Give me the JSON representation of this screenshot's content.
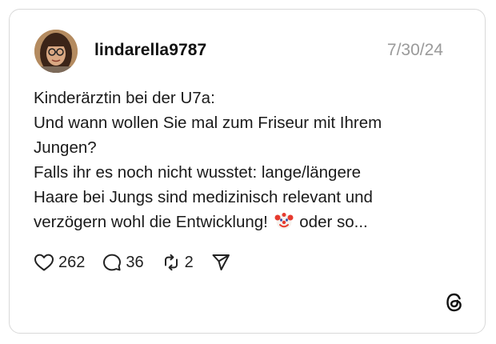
{
  "post": {
    "username": "lindarella9787",
    "date": "7/30/24",
    "lines": {
      "l1": "Kinderärztin bei der U7a:",
      "l2": "Und wann wollen Sie mal zum Friseur mit Ihrem",
      "l3": "Jungen?",
      "l4": "Falls ihr es noch nicht wusstet: lange/längere",
      "l5": "Haare bei Jungs sind medizinisch relevant und",
      "l6a": "verzögern wohl die Entwicklung!",
      "l6b": "oder so..."
    },
    "emoji": "clown-face"
  },
  "actions": {
    "likes": "262",
    "comments": "36",
    "reposts": "2"
  },
  "branding": {
    "logo": "threads-logo"
  }
}
